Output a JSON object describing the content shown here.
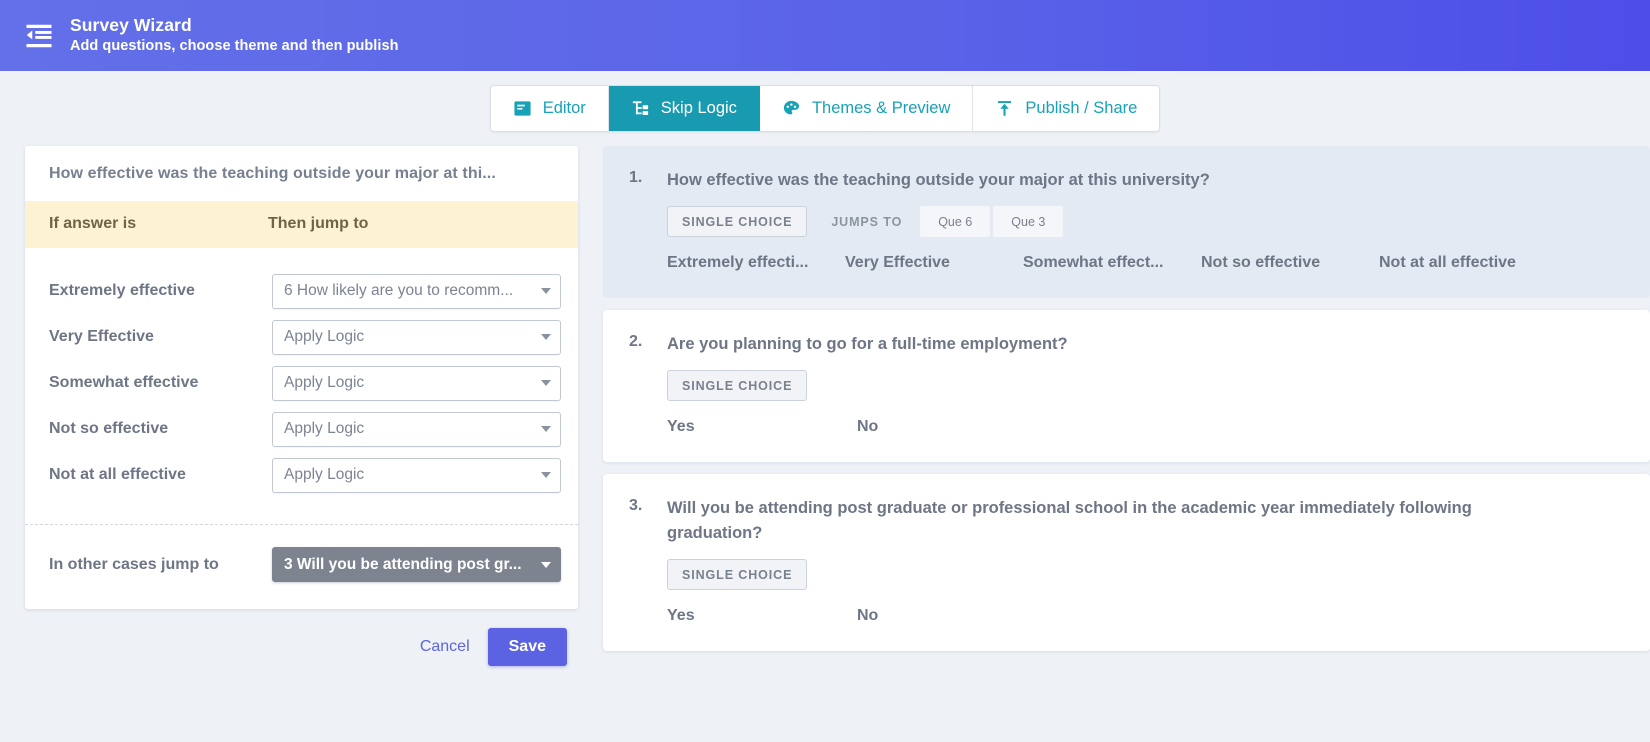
{
  "header": {
    "icon": "format-indent-decrease-icon",
    "title": "Survey Wizard",
    "subtitle": "Add questions, choose theme and then publish",
    "bg_color": "#5a63e8"
  },
  "tabs": {
    "accent_color": "#17a2b8",
    "active_bg": "#189bb0",
    "items": [
      {
        "label": "Editor",
        "icon": "editor-card-icon",
        "active": false
      },
      {
        "label": "Skip Logic",
        "icon": "sitemap-branch-icon",
        "active": true
      },
      {
        "label": "Themes & Preview",
        "icon": "palette-icon",
        "active": false
      },
      {
        "label": "Publish / Share",
        "icon": "upload-arrow-icon",
        "active": false
      }
    ]
  },
  "logic_panel": {
    "question_title": "How effective was the teaching outside your major at thi...",
    "col_header_answer": "If answer is",
    "col_header_jump": "Then jump to",
    "header_bg": "#fdf3d2",
    "rows": [
      {
        "answer": "Extremely effective",
        "jump": "6 How likely are you to recomm...",
        "selected": true
      },
      {
        "answer": "Very Effective",
        "jump": "Apply Logic",
        "selected": false
      },
      {
        "answer": "Somewhat effective",
        "jump": "Apply Logic",
        "selected": false
      },
      {
        "answer": "Not so effective",
        "jump": "Apply Logic",
        "selected": false
      },
      {
        "answer": "Not at all effective",
        "jump": "Apply Logic",
        "selected": false
      }
    ],
    "other_label": "In other cases jump to",
    "other_value": "3 Will you be attending post gr...",
    "cancel_label": "Cancel",
    "save_label": "Save",
    "save_color": "#5b63e3"
  },
  "questions": [
    {
      "number": "1.",
      "text": "How effective was the teaching outside your major at this university?",
      "type_badge": "SINGLE CHOICE",
      "jumps_to_label": "JUMPS TO",
      "jump_chips": [
        "Que 6",
        "Que 3"
      ],
      "options": [
        "Extremely effecti...",
        "Very Effective",
        "Somewhat effect...",
        "Not so effective",
        "Not at all effective"
      ],
      "highlighted": true
    },
    {
      "number": "2.",
      "text": "Are you planning to go for a full-time employment?",
      "type_badge": "SINGLE CHOICE",
      "jumps_to_label": "",
      "jump_chips": [],
      "options": [
        "Yes",
        "No"
      ],
      "highlighted": false
    },
    {
      "number": "3.",
      "text": "Will you be attending post graduate or professional school in the academic year immediately following graduation?",
      "type_badge": "SINGLE CHOICE",
      "jumps_to_label": "",
      "jump_chips": [],
      "options": [
        "Yes",
        "No"
      ],
      "highlighted": false
    }
  ]
}
